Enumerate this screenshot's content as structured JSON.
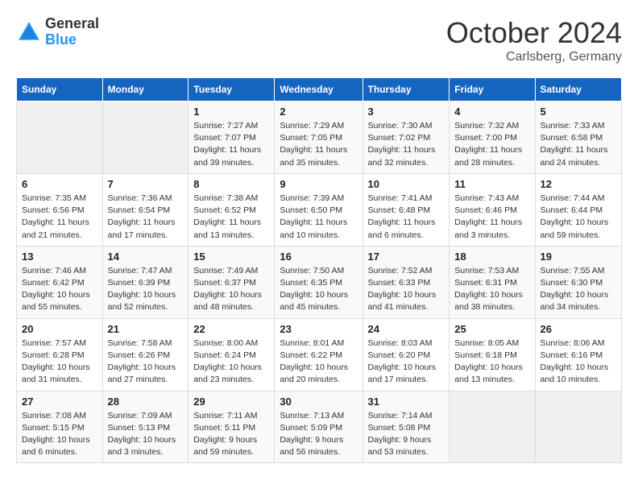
{
  "header": {
    "logo_general": "General",
    "logo_blue": "Blue",
    "month_title": "October 2024",
    "subtitle": "Carlsberg, Germany"
  },
  "calendar": {
    "days_of_week": [
      "Sunday",
      "Monday",
      "Tuesday",
      "Wednesday",
      "Thursday",
      "Friday",
      "Saturday"
    ],
    "weeks": [
      [
        {
          "day": "",
          "info": ""
        },
        {
          "day": "",
          "info": ""
        },
        {
          "day": "1",
          "info": "Sunrise: 7:27 AM\nSunset: 7:07 PM\nDaylight: 11 hours and 39 minutes."
        },
        {
          "day": "2",
          "info": "Sunrise: 7:29 AM\nSunset: 7:05 PM\nDaylight: 11 hours and 35 minutes."
        },
        {
          "day": "3",
          "info": "Sunrise: 7:30 AM\nSunset: 7:02 PM\nDaylight: 11 hours and 32 minutes."
        },
        {
          "day": "4",
          "info": "Sunrise: 7:32 AM\nSunset: 7:00 PM\nDaylight: 11 hours and 28 minutes."
        },
        {
          "day": "5",
          "info": "Sunrise: 7:33 AM\nSunset: 6:58 PM\nDaylight: 11 hours and 24 minutes."
        }
      ],
      [
        {
          "day": "6",
          "info": "Sunrise: 7:35 AM\nSunset: 6:56 PM\nDaylight: 11 hours and 21 minutes."
        },
        {
          "day": "7",
          "info": "Sunrise: 7:36 AM\nSunset: 6:54 PM\nDaylight: 11 hours and 17 minutes."
        },
        {
          "day": "8",
          "info": "Sunrise: 7:38 AM\nSunset: 6:52 PM\nDaylight: 11 hours and 13 minutes."
        },
        {
          "day": "9",
          "info": "Sunrise: 7:39 AM\nSunset: 6:50 PM\nDaylight: 11 hours and 10 minutes."
        },
        {
          "day": "10",
          "info": "Sunrise: 7:41 AM\nSunset: 6:48 PM\nDaylight: 11 hours and 6 minutes."
        },
        {
          "day": "11",
          "info": "Sunrise: 7:43 AM\nSunset: 6:46 PM\nDaylight: 11 hours and 3 minutes."
        },
        {
          "day": "12",
          "info": "Sunrise: 7:44 AM\nSunset: 6:44 PM\nDaylight: 10 hours and 59 minutes."
        }
      ],
      [
        {
          "day": "13",
          "info": "Sunrise: 7:46 AM\nSunset: 6:42 PM\nDaylight: 10 hours and 55 minutes."
        },
        {
          "day": "14",
          "info": "Sunrise: 7:47 AM\nSunset: 6:39 PM\nDaylight: 10 hours and 52 minutes."
        },
        {
          "day": "15",
          "info": "Sunrise: 7:49 AM\nSunset: 6:37 PM\nDaylight: 10 hours and 48 minutes."
        },
        {
          "day": "16",
          "info": "Sunrise: 7:50 AM\nSunset: 6:35 PM\nDaylight: 10 hours and 45 minutes."
        },
        {
          "day": "17",
          "info": "Sunrise: 7:52 AM\nSunset: 6:33 PM\nDaylight: 10 hours and 41 minutes."
        },
        {
          "day": "18",
          "info": "Sunrise: 7:53 AM\nSunset: 6:31 PM\nDaylight: 10 hours and 38 minutes."
        },
        {
          "day": "19",
          "info": "Sunrise: 7:55 AM\nSunset: 6:30 PM\nDaylight: 10 hours and 34 minutes."
        }
      ],
      [
        {
          "day": "20",
          "info": "Sunrise: 7:57 AM\nSunset: 6:28 PM\nDaylight: 10 hours and 31 minutes."
        },
        {
          "day": "21",
          "info": "Sunrise: 7:58 AM\nSunset: 6:26 PM\nDaylight: 10 hours and 27 minutes."
        },
        {
          "day": "22",
          "info": "Sunrise: 8:00 AM\nSunset: 6:24 PM\nDaylight: 10 hours and 23 minutes."
        },
        {
          "day": "23",
          "info": "Sunrise: 8:01 AM\nSunset: 6:22 PM\nDaylight: 10 hours and 20 minutes."
        },
        {
          "day": "24",
          "info": "Sunrise: 8:03 AM\nSunset: 6:20 PM\nDaylight: 10 hours and 17 minutes."
        },
        {
          "day": "25",
          "info": "Sunrise: 8:05 AM\nSunset: 6:18 PM\nDaylight: 10 hours and 13 minutes."
        },
        {
          "day": "26",
          "info": "Sunrise: 8:06 AM\nSunset: 6:16 PM\nDaylight: 10 hours and 10 minutes."
        }
      ],
      [
        {
          "day": "27",
          "info": "Sunrise: 7:08 AM\nSunset: 5:15 PM\nDaylight: 10 hours and 6 minutes."
        },
        {
          "day": "28",
          "info": "Sunrise: 7:09 AM\nSunset: 5:13 PM\nDaylight: 10 hours and 3 minutes."
        },
        {
          "day": "29",
          "info": "Sunrise: 7:11 AM\nSunset: 5:11 PM\nDaylight: 9 hours and 59 minutes."
        },
        {
          "day": "30",
          "info": "Sunrise: 7:13 AM\nSunset: 5:09 PM\nDaylight: 9 hours and 56 minutes."
        },
        {
          "day": "31",
          "info": "Sunrise: 7:14 AM\nSunset: 5:08 PM\nDaylight: 9 hours and 53 minutes."
        },
        {
          "day": "",
          "info": ""
        },
        {
          "day": "",
          "info": ""
        }
      ]
    ]
  }
}
